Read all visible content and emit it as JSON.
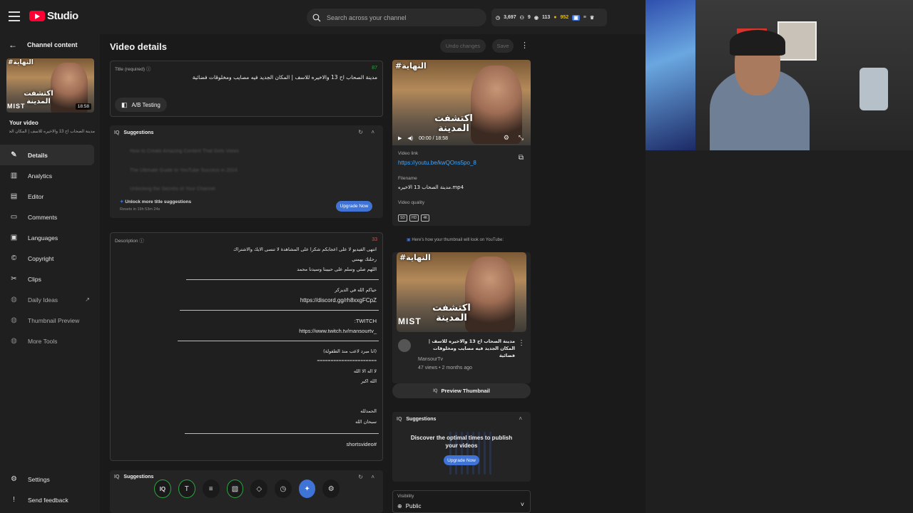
{
  "header": {
    "logo_text": "Studio",
    "search_placeholder": "Search across your channel",
    "stats": [
      "3,697",
      "9",
      "113",
      "952"
    ]
  },
  "sidebar": {
    "back_label": "Channel content",
    "thumb_duration": "18:58",
    "your_video_label": "Your video",
    "your_video_title": "مدينة الصحاب اح 13 والاخيره للاسف | المكان الجديد فيه مصايب ومخلوقات فضائية",
    "items": [
      {
        "label": "Details",
        "icon": "pencil-icon"
      },
      {
        "label": "Analytics",
        "icon": "bar-chart-icon"
      },
      {
        "label": "Editor",
        "icon": "film-editor-icon"
      },
      {
        "label": "Comments",
        "icon": "comment-icon"
      },
      {
        "label": "Languages",
        "icon": "subtitles-icon"
      },
      {
        "label": "Copyright",
        "icon": "copyright-icon"
      },
      {
        "label": "Clips",
        "icon": "scissors-icon"
      },
      {
        "label": "Daily Ideas",
        "icon": "vidiq-icon"
      },
      {
        "label": "Thumbnail Preview",
        "icon": "vidiq-icon"
      },
      {
        "label": "More Tools",
        "icon": "vidiq-icon"
      }
    ],
    "bottom_items": [
      {
        "label": "Settings",
        "icon": "gear-icon"
      },
      {
        "label": "Send feedback",
        "icon": "feedback-icon"
      }
    ]
  },
  "main": {
    "page_title": "Video details",
    "undo_label": "Undo changes",
    "save_label": "Save",
    "title_field": {
      "label": "Title (required)",
      "count": "87",
      "value": "مدينة الصحاب اح 13 والاخيره للاسف | المكان الجديد فيه مصايب ومخلوقات فضائية"
    },
    "ab_testing_label": "A/B Testing",
    "suggestions_label": "Suggestions",
    "suggestion_rows": [
      "How to Create Amazing Content That Gets Views",
      "The Ultimate Guide to YouTube Success in 2024",
      "Unlocking the Secrets of Your Channel"
    ],
    "unlock_label": "Unlock more title suggestions",
    "resets_label": "Resets in 19h 53m 24s",
    "upgrade_label": "Upgrade Now",
    "description": {
      "label": "Description",
      "count": "33",
      "lines": [
        "انتهى الفيديو لا على اعجابكم شكرا على المشاهدة لا تنسى الايك والاشتراك",
        "رحلتك يهمني",
        "اللهم صلي وسلم على حبيبنا وسيدنا محمد",
        "حياكم الله في الديزكر",
        "https://discord.gg/rh8xxgFCpZ",
        ":TWITCH",
        "https://www.twitch.tv/mansourtv_",
        "(انا مبرد لاعب منذ الطفولة)",
        "======================",
        "لا اله الا الله",
        "الله اكبر",
        "الحمدلله",
        "سبحان الله",
        "shortsvideo#"
      ]
    },
    "bottom_suggestions_label": "Suggestions"
  },
  "right": {
    "video_time": "00:00 / 18:58",
    "video_link_label": "Video link",
    "video_link": "https://youtu.be/kwQOns5po_8",
    "filename_label": "Filename",
    "filename": "مدينة الصحاب 13 الاخيره.mp4",
    "quality_label": "Video quality",
    "quality_badges": [
      "SD",
      "HD",
      "4K"
    ],
    "preview_note": "Here's how your thumbnail will look on YouTube:",
    "preview_title": "مدينة الصحاب اح 13 والاخيره للاسف | المكان الجديد فيه مصايب ومخلوقات فضائية",
    "channel": "MansourTv",
    "views": "47 views • 2 months ago",
    "preview_button": "Preview Thumbnail",
    "suggestions_label": "Suggestions",
    "suggestions_text": "Discover the optimal times to publish your videos",
    "upgrade_label": "Upgrade Now",
    "visibility_label": "Visibility",
    "visibility_value": "Public"
  },
  "thumbnail": {
    "tag": "#النهاية",
    "headline": "اكتشفت المدينة",
    "brand": "MIST"
  },
  "colors": {
    "accent": "#3f73d6",
    "brand_red": "#ff0033",
    "count_green": "#2ba640"
  }
}
